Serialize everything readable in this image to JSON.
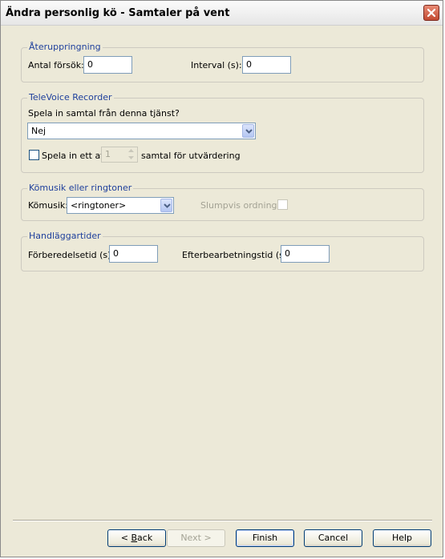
{
  "window": {
    "title": "Ändra personlig kö - Samtaler på vent"
  },
  "retry_group": {
    "legend": "Återuppringning",
    "attempts_label": "Antal försök:",
    "attempts_value": "0",
    "interval_label": "Interval (s):",
    "interval_value": "0"
  },
  "recorder_group": {
    "legend": "TeleVoice Recorder",
    "question": "Spela in samtal från denna tjänst?",
    "record_selected": "Nej",
    "sample_checked": false,
    "sample_prefix": "Spela in ett av",
    "sample_value": "1",
    "sample_suffix": "samtal för utvärdering"
  },
  "music_group": {
    "legend": "Kömusik eller ringtoner",
    "music_label": "Kömusik:",
    "music_selected": "<ringtoner>",
    "random_label": "Slumpvis ordning:",
    "random_checked": false
  },
  "handling_group": {
    "legend": "Handläggartider",
    "prep_label": "Förberedelsetid (s):",
    "prep_value": "0",
    "wrapup_label": "Efterbearbetningstid (s):",
    "wrapup_value": "0"
  },
  "buttons": {
    "back_prefix": "< ",
    "back_mnemonic": "B",
    "back_rest": "ack",
    "next": "Next >",
    "finish": "Finish",
    "cancel": "Cancel",
    "help": "Help"
  }
}
